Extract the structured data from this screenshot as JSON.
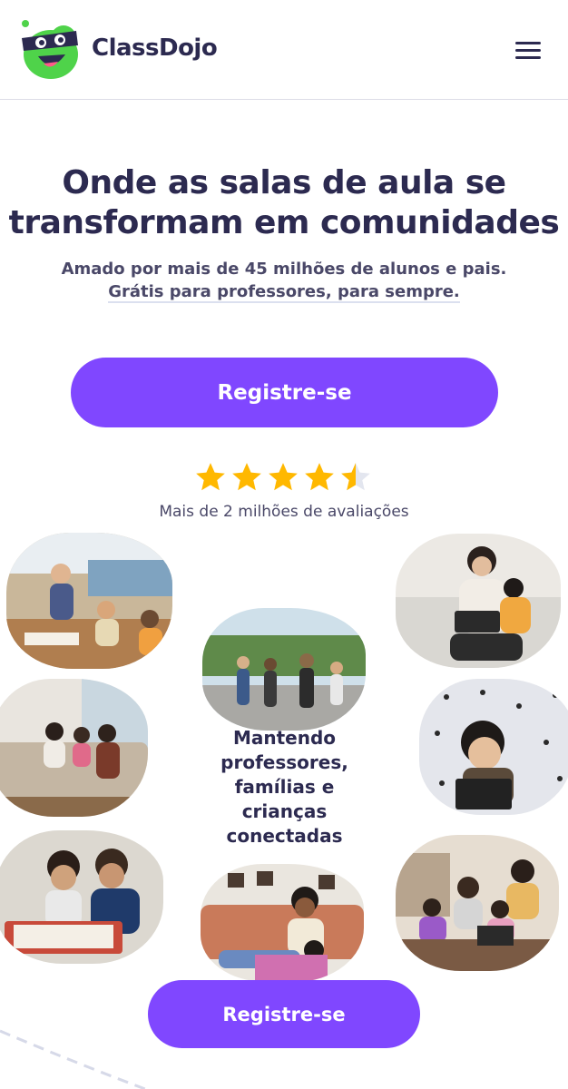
{
  "header": {
    "brand": "ClassDojo",
    "logo_icon": "classdojo-monster-logo",
    "menu_icon": "hamburger-menu-icon"
  },
  "hero": {
    "title_line1": "Onde as salas de aula se",
    "title_line2": "transformam em comunidades",
    "subtitle_line1": "Amado por mais de 45 milhões de alunos e pais.",
    "subtitle_line2": "Grátis para professores, para sempre."
  },
  "cta": {
    "primary_label": "Registre-se",
    "secondary_label": "Registre-se"
  },
  "rating": {
    "stars": 4.5,
    "max": 5,
    "reviews_text": "Mais de 2 milhões de avaliações"
  },
  "collage": {
    "center_text_lines": [
      "Mantendo",
      "professores,",
      "famílias e",
      "crianças",
      "conectadas"
    ]
  },
  "colors": {
    "accent": "#8047ff",
    "text": "#2c2a50",
    "star": "#ffb800",
    "logo_green": "#4fd34a"
  }
}
